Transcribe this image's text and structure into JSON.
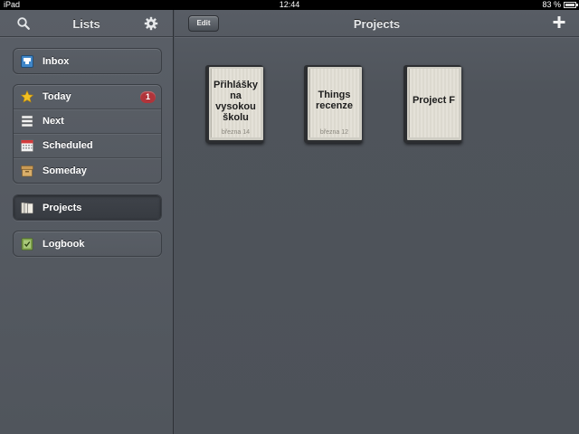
{
  "status_bar": {
    "carrier": "iPad",
    "time": "12:44",
    "battery_text": "83 %",
    "battery_level": 0.83
  },
  "sidebar": {
    "title": "Lists",
    "search_icon": "search-icon",
    "settings_icon": "gear-icon",
    "inbox": {
      "label": "Inbox",
      "icon": "inbox-icon"
    },
    "focus_items": [
      {
        "label": "Today",
        "icon": "star-icon",
        "badge": "1"
      },
      {
        "label": "Next",
        "icon": "stack-icon"
      },
      {
        "label": "Scheduled",
        "icon": "calendar-icon"
      },
      {
        "label": "Someday",
        "icon": "box-icon"
      }
    ],
    "projects": {
      "label": "Projects",
      "icon": "books-icon",
      "selected": true
    },
    "logbook": {
      "label": "Logbook",
      "icon": "logbook-icon"
    }
  },
  "main": {
    "title": "Projects",
    "edit_label": "Edit",
    "add_icon": "plus-icon",
    "projects": [
      {
        "name_lines": [
          "Přihlášky",
          "na",
          "vysokou",
          "školu"
        ],
        "date": "března 14"
      },
      {
        "name_lines": [
          "Things",
          "recenze"
        ],
        "date": "března 12"
      },
      {
        "name_lines": [
          "Project F"
        ],
        "date": ""
      }
    ]
  },
  "colors": {
    "badge": "#b0343a",
    "background": "#4e535b",
    "cover": "#e4e1d8"
  }
}
